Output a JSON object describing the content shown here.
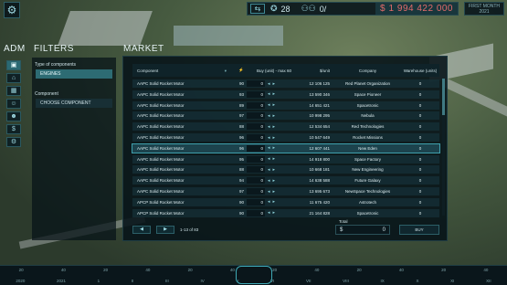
{
  "topbar": {
    "mode": "⇆",
    "res1_value": "28",
    "res2_value": "0/",
    "money": "1 994 422 000",
    "date_line1": "FIRST MONTH",
    "date_line2": "2021"
  },
  "left": {
    "adm_title": "ADM",
    "filters_title": "FILTERS",
    "type_label": "Type of components",
    "type_value": "ENGINES",
    "component_label": "Component",
    "component_value": "CHOOSE COMPONENT",
    "side_icons": [
      "building-icon",
      "factory-icon",
      "grid-icon",
      "people-icon",
      "people-alt-icon",
      "dollar-icon",
      "gear-icon"
    ]
  },
  "market": {
    "title": "MARKET",
    "headers": {
      "component": "Component",
      "lock": "",
      "buy": "Buy (unit) - max 60",
      "unit": "$/unit",
      "company": "Company",
      "warehouse": "Warehouse (units)"
    },
    "rows": [
      {
        "name": "AAPC Solid Rocket Motor",
        "lock": "90",
        "buy": "0",
        "unit": "12 106 125",
        "company": "Red Planet Organization",
        "ware": "0"
      },
      {
        "name": "AAPC Solid Rocket Motor",
        "lock": "93",
        "buy": "0",
        "unit": "13 590 346",
        "company": "Space Pioneer",
        "ware": "0"
      },
      {
        "name": "AAPC Solid Rocket Motor",
        "lock": "89",
        "buy": "0",
        "unit": "14 651 421",
        "company": "Spacetronic",
        "ware": "0"
      },
      {
        "name": "AAPC Solid Rocket Motor",
        "lock": "97",
        "buy": "0",
        "unit": "10 998 295",
        "company": "Nebula",
        "ware": "0"
      },
      {
        "name": "AAPC Solid Rocket Motor",
        "lock": "88",
        "buy": "0",
        "unit": "12 534 654",
        "company": "Red Technologies",
        "ware": "0"
      },
      {
        "name": "AAPC Solid Rocket Motor",
        "lock": "96",
        "buy": "0",
        "unit": "10 547 649",
        "company": "Rocket Missions",
        "ware": "0"
      },
      {
        "name": "AAPC Solid Rocket Motor",
        "lock": "96",
        "buy": "0",
        "unit": "12 607 441",
        "company": "New Eden",
        "ware": "0"
      },
      {
        "name": "AAPC Solid Rocket Motor",
        "lock": "95",
        "buy": "0",
        "unit": "14 918 800",
        "company": "Space Factory",
        "ware": "0"
      },
      {
        "name": "AAPC Solid Rocket Motor",
        "lock": "88",
        "buy": "0",
        "unit": "10 668 181",
        "company": "New Engineering",
        "ware": "0"
      },
      {
        "name": "AAPC Solid Rocket Motor",
        "lock": "94",
        "buy": "0",
        "unit": "14 638 588",
        "company": "Future Galaxy",
        "ware": "0"
      },
      {
        "name": "AAPC Solid Rocket Motor",
        "lock": "97",
        "buy": "0",
        "unit": "13 695 673",
        "company": "NewSpace Technologies",
        "ware": "0"
      },
      {
        "name": "APCP Solid Rocket Motor",
        "lock": "90",
        "buy": "0",
        "unit": "11 675 420",
        "company": "Astrotech",
        "ware": "0"
      },
      {
        "name": "APCP Solid Rocket Motor",
        "lock": "90",
        "buy": "0",
        "unit": "21 164 828",
        "company": "Spacetronic",
        "ware": "0"
      }
    ],
    "pager_text": "1-13 of 83",
    "total_label": "Total",
    "total_currency": "$",
    "total_value": "0",
    "buy_label": "BUY"
  },
  "timeline": {
    "top": [
      "20",
      "40",
      "20",
      "40",
      "20",
      "40",
      "20",
      "40",
      "20",
      "40",
      "20",
      "40"
    ],
    "bottom": [
      "2020",
      "2021",
      "1",
      "II",
      "III",
      "IV",
      "V",
      "VI",
      "VII",
      "VIII",
      "IX",
      "X",
      "XI",
      "XII"
    ]
  }
}
